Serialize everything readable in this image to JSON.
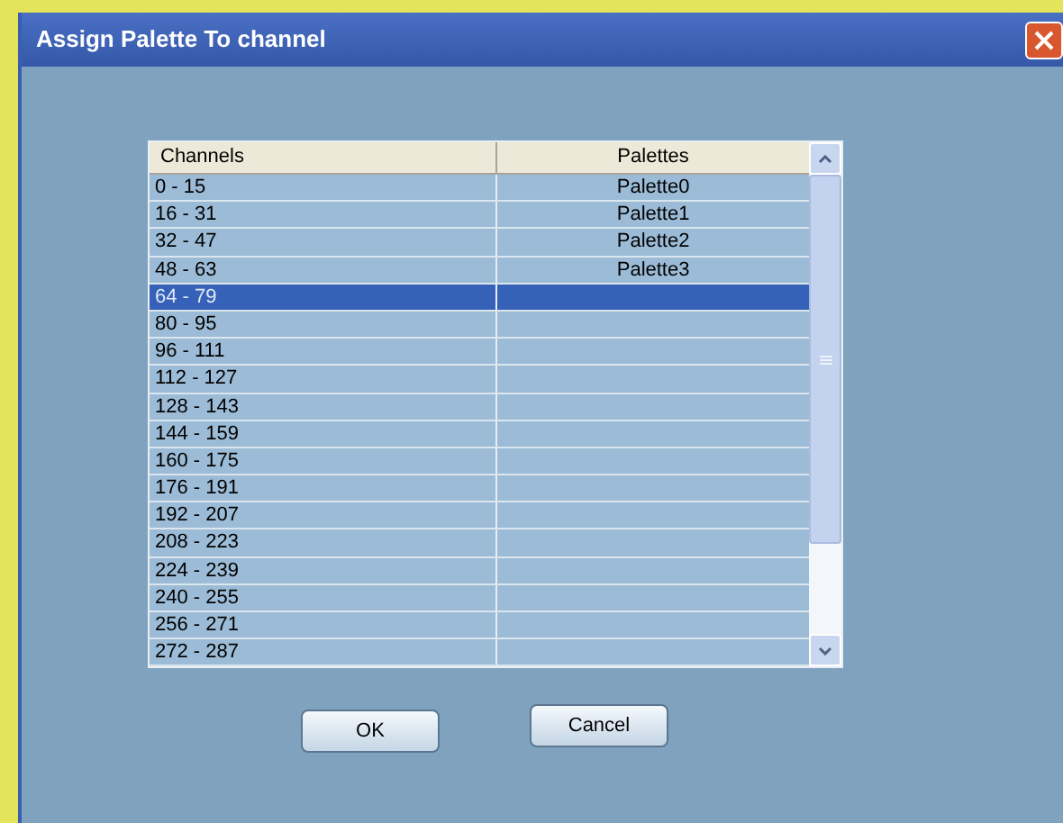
{
  "window": {
    "title": "Assign Palette To channel"
  },
  "table": {
    "columns": [
      "Channels",
      "Palettes"
    ],
    "rows": [
      {
        "channels": "0 - 15",
        "palettes": "Palette0",
        "selected": false
      },
      {
        "channels": "16 - 31",
        "palettes": "Palette1",
        "selected": false
      },
      {
        "channels": "32 - 47",
        "palettes": "Palette2",
        "selected": false
      },
      {
        "channels": "48 - 63",
        "palettes": "Palette3",
        "selected": false
      },
      {
        "channels": "64 - 79",
        "selected": true
      },
      {
        "channels": "80 - 95",
        "selected": false
      },
      {
        "channels": "96 - 111",
        "selected": false
      },
      {
        "channels": "112 - 127",
        "selected": false
      },
      {
        "channels": "128 - 143",
        "selected": false
      },
      {
        "channels": "144 - 159",
        "selected": false
      },
      {
        "channels": "160 - 175",
        "selected": false
      },
      {
        "channels": "176 - 191",
        "selected": false
      },
      {
        "channels": "192 - 207",
        "selected": false
      },
      {
        "channels": "208 - 223",
        "selected": false
      },
      {
        "channels": "224 - 239",
        "selected": false
      },
      {
        "channels": "240 - 255",
        "selected": false
      },
      {
        "channels": "256 - 271",
        "selected": false
      },
      {
        "channels": "272 - 287",
        "selected": false
      }
    ]
  },
  "buttons": [
    "OK",
    "Cancel"
  ]
}
